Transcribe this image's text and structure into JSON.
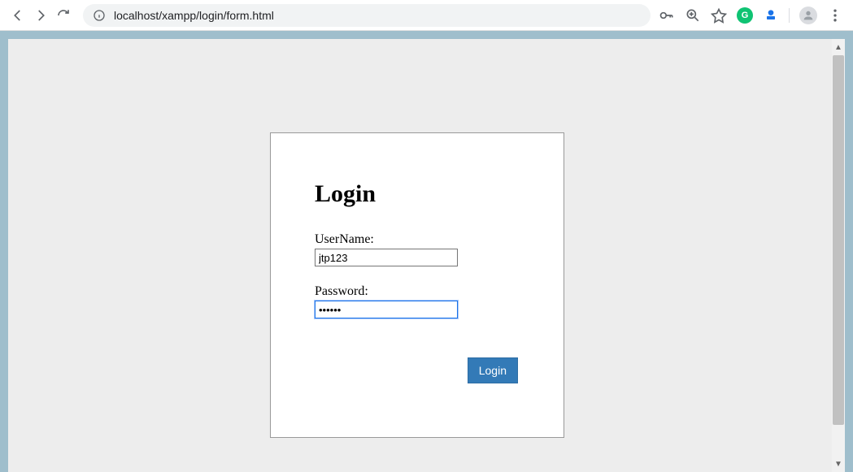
{
  "browser": {
    "url": "localhost/xampp/login/form.html",
    "url_prefix": "localhost"
  },
  "page": {
    "title": "Login",
    "username_label": "UserName:",
    "username_value": "jtp123",
    "password_label": "Password:",
    "password_value": "••••••",
    "login_button": "Login"
  }
}
